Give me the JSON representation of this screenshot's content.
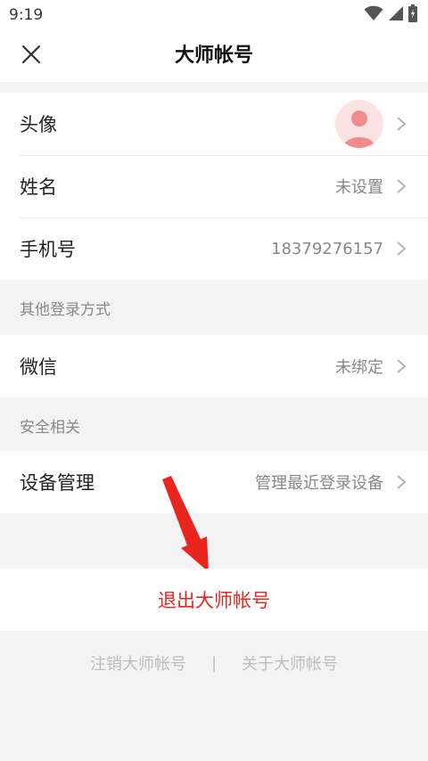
{
  "status_bar": {
    "time": "9:19",
    "icons": [
      "wifi-icon",
      "signal-icon",
      "battery-icon"
    ]
  },
  "nav": {
    "title": "大师帐号",
    "close_icon": "close-icon"
  },
  "profile": {
    "rows": [
      {
        "label": "头像",
        "value": ""
      },
      {
        "label": "姓名",
        "value": "未设置"
      },
      {
        "label": "手机号",
        "value": "18379276157"
      }
    ]
  },
  "other_login": {
    "header": "其他登录方式",
    "rows": [
      {
        "label": "微信",
        "value": "未绑定"
      }
    ]
  },
  "security": {
    "header": "安全相关",
    "rows": [
      {
        "label": "设备管理",
        "value": "管理最近登录设备"
      }
    ]
  },
  "logout_label": "退出大师帐号",
  "footer": {
    "cancel_account": "注销大师帐号",
    "separator": "|",
    "about": "关于大师帐号"
  },
  "colors": {
    "accent_red": "#e8261e",
    "avatar_bg": "#fde3e3",
    "avatar_fg": "#f08c8c",
    "page_bg": "#f3f3f3"
  }
}
